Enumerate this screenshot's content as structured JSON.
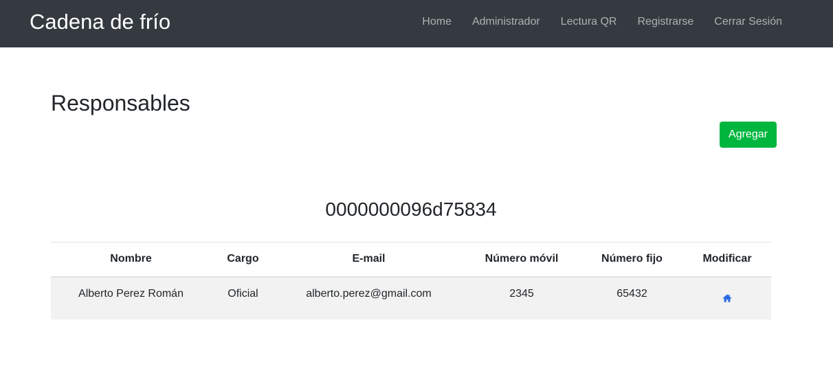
{
  "navbar": {
    "brand": "Cadena de frío",
    "links": [
      "Home",
      "Administrador",
      "Lectura QR",
      "Registrarse",
      "Cerrar Sesión"
    ]
  },
  "page": {
    "title": "Responsables",
    "add_label": "Agregar",
    "device_id": "0000000096d75834"
  },
  "table": {
    "headers": [
      "Nombre",
      "Cargo",
      "E-mail",
      "Número móvil",
      "Número fijo",
      "Modificar"
    ],
    "rows": [
      {
        "nombre": "Alberto Perez Román",
        "cargo": "Oficial",
        "email": "alberto.perez@gmail.com",
        "movil": "2345",
        "fijo": "65432",
        "modificar_icon": "home-icon"
      }
    ]
  },
  "colors": {
    "navbar_bg": "#343a40",
    "add_button": "#00b63e",
    "icon_blue": "#2d6be4",
    "row_bg": "#f2f2f2"
  }
}
